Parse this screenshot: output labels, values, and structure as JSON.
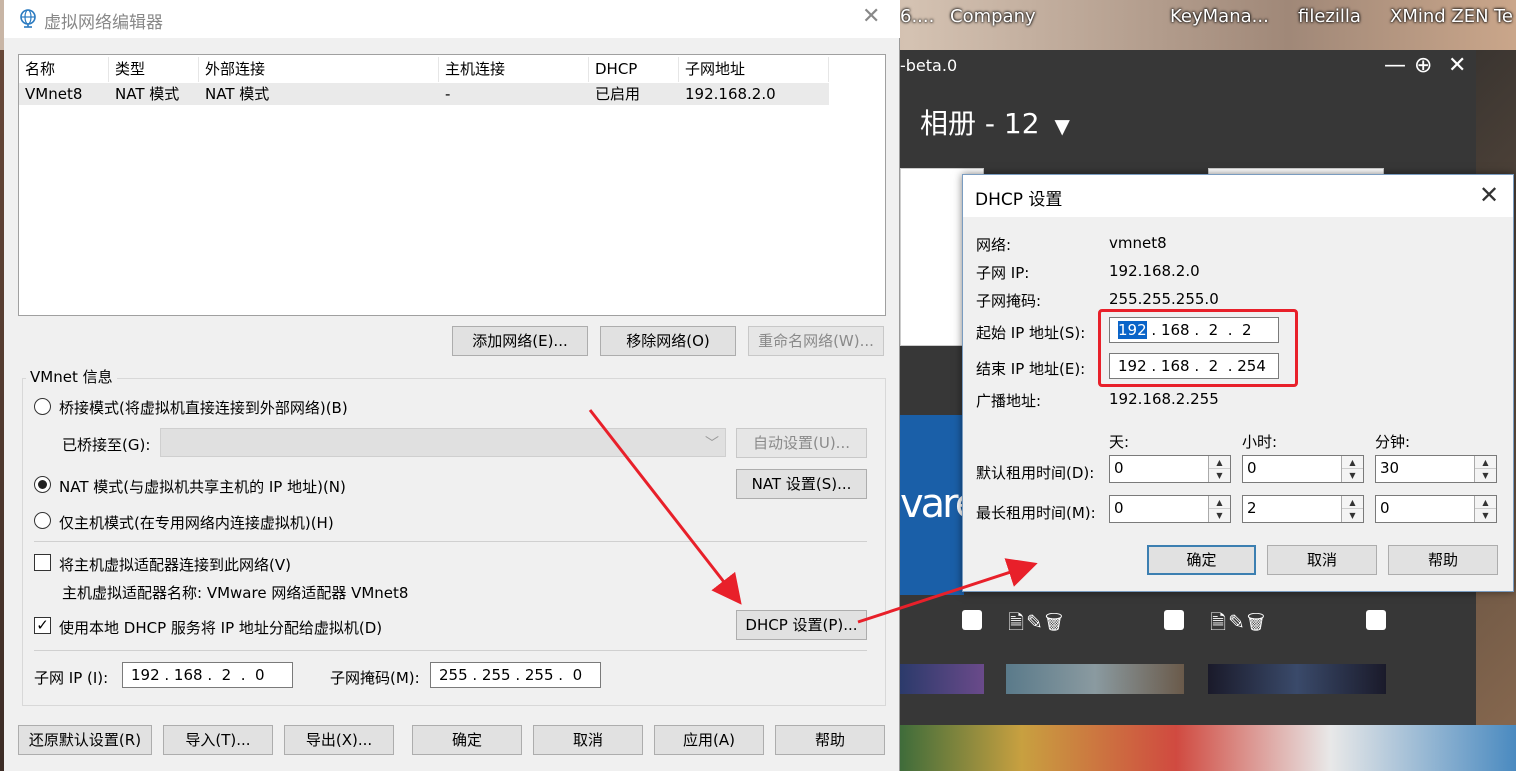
{
  "desktop": {
    "taskbar_items": [
      "6....",
      "Company",
      "KeyMana...",
      "filezilla",
      "XMind ZEN",
      "Te"
    ],
    "viewer_title": "-beta.0",
    "viewer_controls": {
      "minimize": "—",
      "add": "⊕",
      "close": "✕"
    },
    "album_title": "相册 - 12",
    "tile_text": "vare"
  },
  "vne": {
    "title": "虚拟网络编辑器",
    "table": {
      "columns": [
        "名称",
        "类型",
        "外部连接",
        "主机连接",
        "DHCP",
        "子网地址"
      ],
      "rows": [
        [
          "VMnet8",
          "NAT 模式",
          "NAT 模式",
          "-",
          "已启用",
          "192.168.2.0"
        ]
      ]
    },
    "buttons": {
      "add_network": "添加网络(E)...",
      "remove_network": "移除网络(O)",
      "rename_network": "重命名网络(W)..."
    },
    "info": {
      "legend": "VMnet 信息",
      "bridged_label": "桥接模式(将虚拟机直接连接到外部网络)(B)",
      "bridged_to_label": "已桥接至(G):",
      "auto_settings": "自动设置(U)...",
      "nat_label": "NAT 模式(与虚拟机共享主机的 IP 地址)(N)",
      "nat_settings": "NAT 设置(S)...",
      "hostonly_label": "仅主机模式(在专用网络内连接虚拟机)(H)",
      "connect_adapter_label": "将主机虚拟适配器连接到此网络(V)",
      "adapter_name_label": "主机虚拟适配器名称: VMware 网络适配器 VMnet8",
      "use_dhcp_label": "使用本地 DHCP 服务将 IP 地址分配给虚拟机(D)",
      "dhcp_settings": "DHCP 设置(P)...",
      "subnet_ip_label": "子网 IP (I):",
      "subnet_ip": "192 . 168 .  2  .  0",
      "subnet_mask_label": "子网掩码(M):",
      "subnet_mask": "255 . 255 . 255 .  0",
      "mode_selected": "nat",
      "connect_adapter_checked": false,
      "use_dhcp_checked": true
    },
    "footer": {
      "restore": "还原默认设置(R)",
      "import": "导入(T)...",
      "export": "导出(X)...",
      "ok": "确定",
      "cancel": "取消",
      "apply": "应用(A)",
      "help": "帮助"
    }
  },
  "dhcp": {
    "title": "DHCP 设置",
    "network_label": "网络:",
    "network": "vmnet8",
    "subnet_ip_label": "子网 IP:",
    "subnet_ip": "192.168.2.0",
    "subnet_mask_label": "子网掩码:",
    "subnet_mask": "255.255.255.0",
    "start_ip_label": "起始 IP 地址(S):",
    "start_ip_first": "192",
    "start_ip_rest": " . 168 .  2  .  2",
    "end_ip_label": "结束 IP 地址(E):",
    "end_ip": "192 . 168 .  2  . 254",
    "broadcast_label": "广播地址:",
    "broadcast": "192.168.2.255",
    "col_days": "天:",
    "col_hours": "小时:",
    "col_minutes": "分钟:",
    "default_lease_label": "默认租用时间(D):",
    "default_lease": [
      "0",
      "0",
      "30"
    ],
    "max_lease_label": "最长租用时间(M):",
    "max_lease": [
      "0",
      "2",
      "0"
    ],
    "ok": "确定",
    "cancel": "取消",
    "help": "帮助"
  },
  "colors": {
    "annotation_red": "#e8202a",
    "selection_blue": "#0a64c8",
    "default_button_border": "#3c7fb1"
  }
}
